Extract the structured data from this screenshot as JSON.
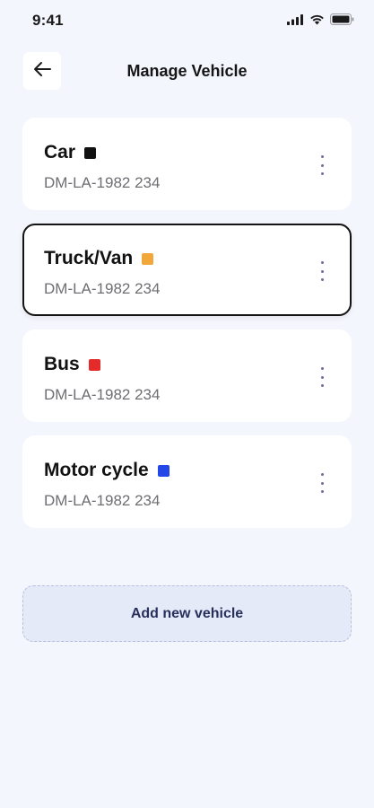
{
  "status_bar": {
    "time": "9:41",
    "icons": [
      "signal-icon",
      "wifi-icon",
      "battery-icon"
    ]
  },
  "header": {
    "title": "Manage Vehicle",
    "back_icon": "arrow-left-icon"
  },
  "vehicles": [
    {
      "name": "Car",
      "plate": "DM-LA-1982 234",
      "color": "#111111",
      "selected": false
    },
    {
      "name": "Truck/Van",
      "plate": "DM-LA-1982 234",
      "color": "#f0a83a",
      "selected": true
    },
    {
      "name": "Bus",
      "plate": "DM-LA-1982 234",
      "color": "#e52a2a",
      "selected": false
    },
    {
      "name": "Motor cycle",
      "plate": "DM-LA-1982 234",
      "color": "#2547e8",
      "selected": false
    }
  ],
  "add_button": {
    "label": "Add new vehicle"
  },
  "colors": {
    "background": "#f4f6fd",
    "card": "#ffffff",
    "add_button_bg": "#e5eaf8",
    "add_button_text": "#27305a",
    "more_icon": "#6b6f99"
  }
}
